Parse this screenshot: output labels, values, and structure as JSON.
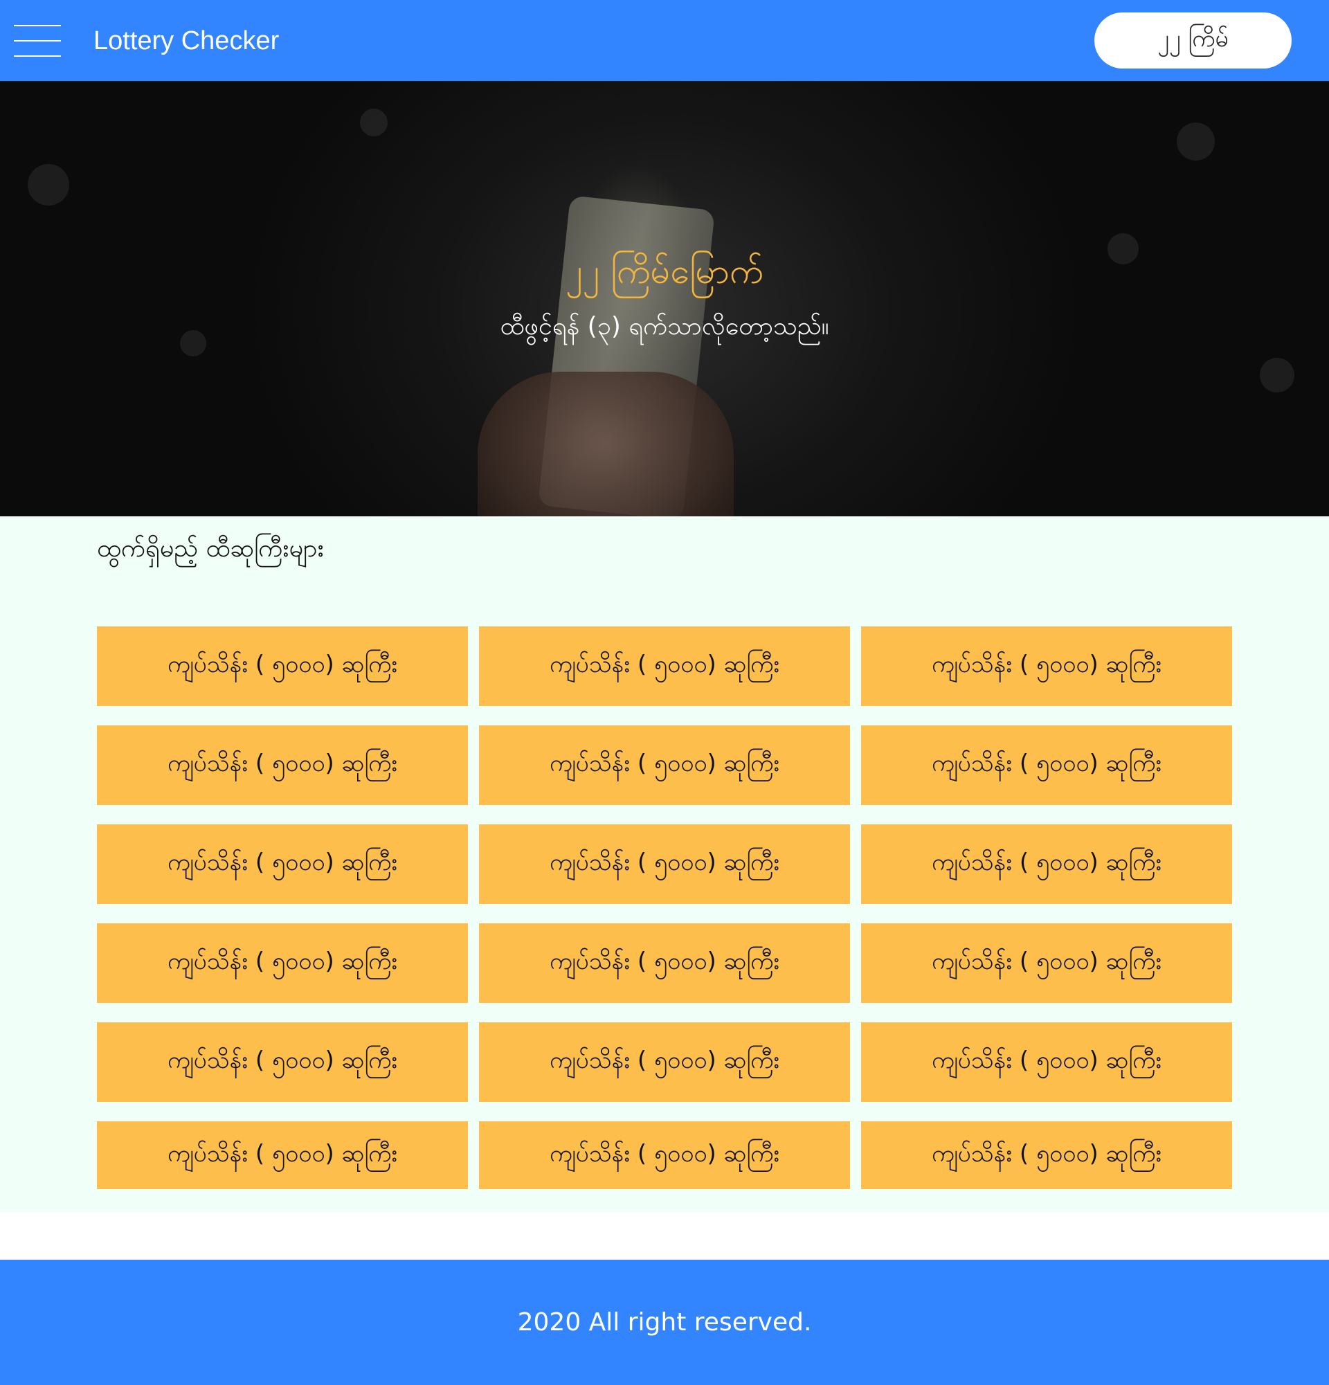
{
  "header": {
    "menu_icon": "hamburger-menu-icon",
    "title": "Lottery Checker",
    "round_label": "၂၂ ကြိမ်"
  },
  "hero": {
    "title": "၂၂ ကြိမ်မြောက်",
    "subtitle": "ထီဖွင့်ရန် (၃) ရက်သာလိုတော့သည်။"
  },
  "prizes": {
    "section_title": "ထွက်ရှိမည့် ထီဆုကြီးများ",
    "items": [
      "ကျပ်သိန်း ( ၅၀၀၀) ဆုကြီး",
      "ကျပ်သိန်း ( ၅၀၀၀) ဆုကြီး",
      "ကျပ်သိန်း ( ၅၀၀၀) ဆုကြီး",
      "ကျပ်သိန်း ( ၅၀၀၀) ဆုကြီး",
      "ကျပ်သိန်း ( ၅၀၀၀) ဆုကြီး",
      "ကျပ်သိန်း ( ၅၀၀၀) ဆုကြီး",
      "ကျပ်သိန်း ( ၅၀၀၀) ဆုကြီး",
      "ကျပ်သိန်း ( ၅၀၀၀) ဆုကြီး",
      "ကျပ်သိန်း ( ၅၀၀၀) ဆုကြီး",
      "ကျပ်သိန်း ( ၅၀၀၀) ဆုကြီး",
      "ကျပ်သိန်း ( ၅၀၀၀) ဆုကြီး",
      "ကျပ်သိန်း ( ၅၀၀၀) ဆုကြီး",
      "ကျပ်သိန်း ( ၅၀၀၀) ဆုကြီး",
      "ကျပ်သိန်း ( ၅၀၀၀) ဆုကြီး",
      "ကျပ်သိန်း ( ၅၀၀၀) ဆုကြီး",
      "ကျပ်သိန်း ( ၅၀၀၀) ဆုကြီး",
      "ကျပ်သိန်း ( ၅၀၀၀) ဆုကြီး",
      "ကျပ်သိန်း ( ၅၀၀၀) ဆုကြီး"
    ]
  },
  "footer": {
    "text": "2020 All right reserved."
  },
  "colors": {
    "primary": "#3385ff",
    "prize_card": "#fdbe4b",
    "hero_title": "#f5b63e",
    "content_bg": "#f0fff8"
  }
}
